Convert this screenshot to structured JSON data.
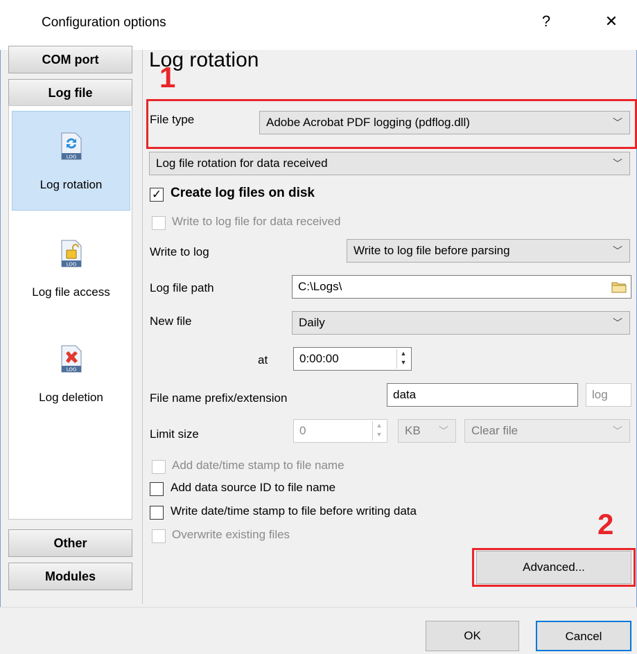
{
  "window": {
    "title": "Configuration options",
    "help_glyph": "?",
    "close_glyph": "✕"
  },
  "sidebar": {
    "com_port": "COM port",
    "log_file": "Log file",
    "items": [
      {
        "label": "Log rotation",
        "icon": "log-rotation-icon",
        "selected": true
      },
      {
        "label": "Log file access",
        "icon": "log-file-access-icon",
        "selected": false
      },
      {
        "label": "Log deletion",
        "icon": "log-deletion-icon",
        "selected": false
      }
    ],
    "other": "Other",
    "modules": "Modules",
    "icon_caption": "LOG"
  },
  "main": {
    "heading": "Log rotation",
    "file_type": {
      "label": "File type",
      "value": "Adobe Acrobat PDF logging (pdflog.dll)"
    },
    "rotation_combo": "Log file rotation for data received",
    "create_log": {
      "label": "Create log files on disk",
      "checked": true
    },
    "write_received": {
      "label": "Write to log file for data received",
      "disabled": true
    },
    "write_to_log": {
      "label": "Write to log",
      "value": "Write to log file before parsing"
    },
    "log_file_path": {
      "label": "Log file path",
      "value": "C:\\Logs\\"
    },
    "new_file": {
      "label": "New file",
      "value": "Daily"
    },
    "at": {
      "label": "at",
      "value": "0:00:00"
    },
    "prefix": {
      "label": "File name prefix/extension",
      "prefix_value": "data",
      "extension_value": "log"
    },
    "limit": {
      "label": "Limit size",
      "value": "0",
      "unit": "KB",
      "action": "Clear file"
    },
    "options": [
      {
        "label": "Add date/time stamp to file name",
        "disabled": true
      },
      {
        "label": "Add data source ID to file name",
        "disabled": false
      },
      {
        "label": "Write date/time stamp to file before writing data",
        "disabled": false
      },
      {
        "label": "Overwrite existing files",
        "disabled": true
      }
    ],
    "advanced_button": "Advanced..."
  },
  "annotations": {
    "marker_1": "1",
    "marker_2": "2",
    "color": "#e8262a"
  },
  "footer": {
    "ok": "OK",
    "cancel": "Cancel"
  },
  "colors": {
    "selected_bg": "#cde3f7",
    "window_bg": "#f0f0f0"
  }
}
